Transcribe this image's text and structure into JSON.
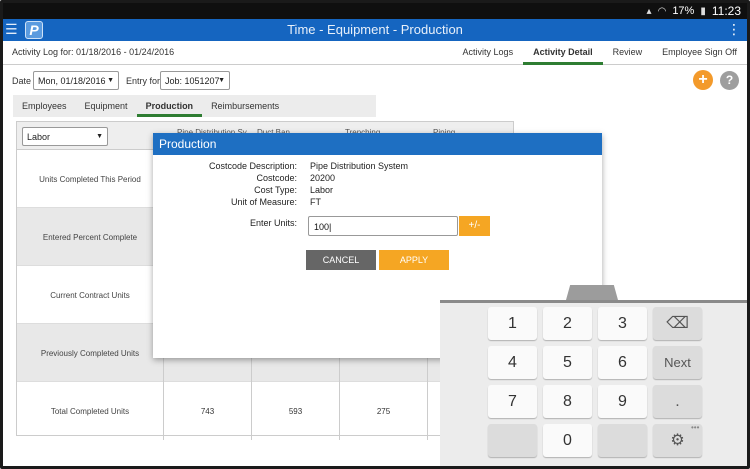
{
  "status": {
    "battery": "17%",
    "time": "11:23"
  },
  "appbar": {
    "title": "Time - Equipment - Production",
    "logo": "P"
  },
  "subheader": {
    "log_label": "Activity Log for: 01/18/2016 - 01/24/2016",
    "tabs": [
      "Activity Logs",
      "Activity Detail",
      "Review",
      "Employee Sign Off"
    ],
    "active_tab": "Activity Detail"
  },
  "daterow": {
    "date_label": "Date",
    "date_value": "Mon, 01/18/2016",
    "entry_label": "Entry for",
    "entry_value": "Job: 1051207",
    "add_label": "+",
    "help_label": "?"
  },
  "subtabs": {
    "items": [
      "Employees",
      "Equipment",
      "Production",
      "Reimbursements"
    ],
    "active": "Production"
  },
  "grid": {
    "type_select": "Labor",
    "column_heads": [
      "Pipe Distribution Sy...",
      "Duct Ban...",
      "Trenching",
      "Piping"
    ],
    "rows": [
      {
        "label": "Units Completed This Period",
        "values": [
          "",
          "",
          "",
          ""
        ]
      },
      {
        "label": "Entered Percent Complete",
        "values": [
          "",
          "",
          "",
          ""
        ]
      },
      {
        "label": "Current Contract Units",
        "values": [
          "",
          "",
          "",
          ""
        ]
      },
      {
        "label": "Previously Completed Units",
        "values": [
          "",
          "",
          "",
          ""
        ]
      },
      {
        "label": "Total Completed Units",
        "values": [
          "743",
          "593",
          "275",
          ""
        ]
      }
    ]
  },
  "dialog": {
    "title": "Production",
    "fields": [
      {
        "label": "Costcode Description:",
        "value": "Pipe Distribution System"
      },
      {
        "label": "Costcode:",
        "value": "20200"
      },
      {
        "label": "Cost Type:",
        "value": "Labor"
      },
      {
        "label": "Unit of Measure:",
        "value": "FT"
      }
    ],
    "units_label": "Enter Units:",
    "units_value": "100|",
    "plusminus": "+/-",
    "cancel": "CANCEL",
    "apply": "APPLY"
  },
  "keyboard": {
    "keys": [
      "1",
      "2",
      "3",
      "4",
      "5",
      "6",
      "7",
      "8",
      "9",
      "0"
    ],
    "next": "Next",
    "dot": ".",
    "more": "•••"
  },
  "colors": {
    "appbar": "#1565c0",
    "accent": "#f5a623",
    "active_tab": "#2e7d32"
  }
}
